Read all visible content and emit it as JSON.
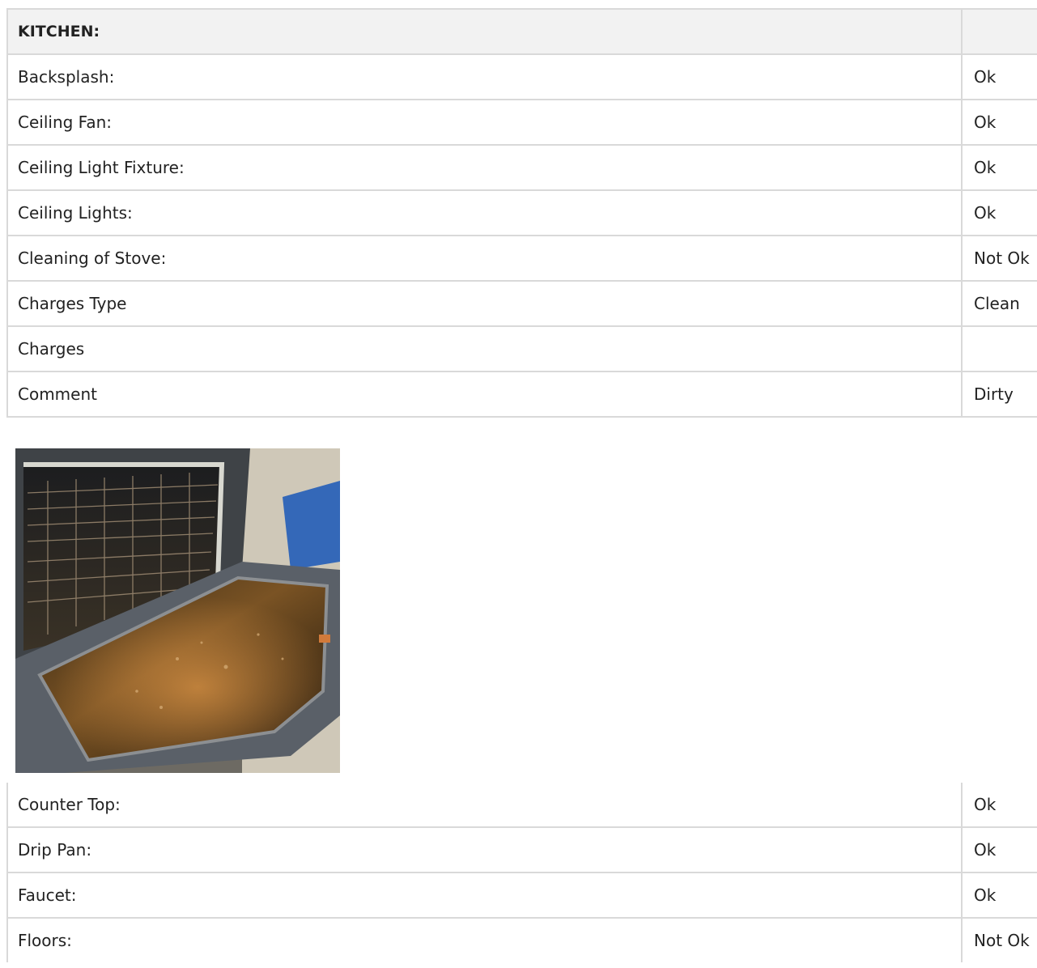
{
  "section": {
    "title": "KITCHEN:",
    "value": ""
  },
  "rows": [
    {
      "label": "Backsplash:",
      "value": "Ok"
    },
    {
      "label": "Ceiling Fan:",
      "value": "Ok"
    },
    {
      "label": "Ceiling Light Fixture:",
      "value": "Ok"
    },
    {
      "label": "Ceiling Lights:",
      "value": "Ok"
    },
    {
      "label": "Cleaning of Stove:",
      "value": "Not Ok"
    },
    {
      "label": "Charges Type",
      "value": "Clean"
    },
    {
      "label": "Charges",
      "value": ""
    },
    {
      "label": "Comment",
      "value": "Dirty"
    }
  ],
  "photo": {
    "subject": "open oven with dirty door",
    "icon": "oven-photo"
  },
  "rows2": [
    {
      "label": "Counter Top:",
      "value": "Ok"
    },
    {
      "label": "Drip Pan:",
      "value": "Ok"
    },
    {
      "label": "Faucet:",
      "value": "Ok"
    },
    {
      "label": "Floors:",
      "value": "Not Ok"
    }
  ],
  "colors": {
    "border": "#d9d9d9",
    "header_bg": "#f2f2f2",
    "text": "#222222"
  }
}
